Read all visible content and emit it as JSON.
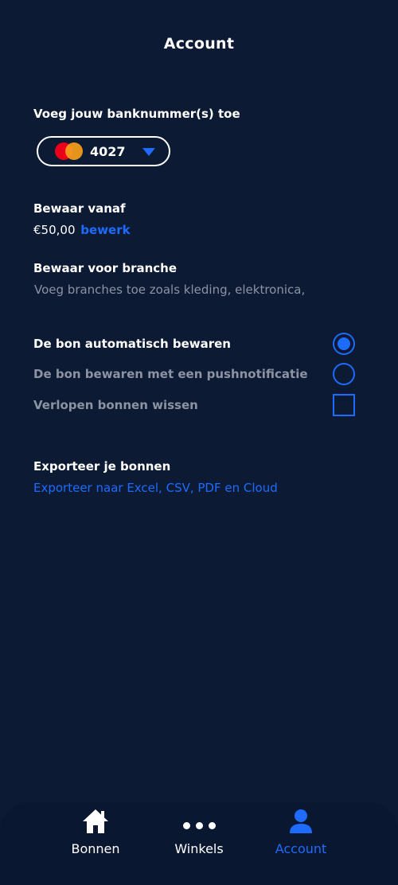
{
  "header": {
    "title": "Account"
  },
  "bank": {
    "label": "Voeg jouw banknummer(s) toe",
    "card_icon": "mastercard-logo",
    "card_digits": "4027"
  },
  "save_from": {
    "label": "Bewaar vanaf",
    "amount": "€50,00",
    "edit_label": "bewerk"
  },
  "branch": {
    "label": "Bewaar voor branche",
    "placeholder": "Voeg branches toe zoals kleding, elektronica,"
  },
  "options": [
    {
      "label": "De bon automatisch bewaren",
      "control": "radio",
      "checked": true
    },
    {
      "label": "De bon bewaren met een pushnotificatie",
      "control": "radio",
      "checked": false
    },
    {
      "label": "Verlopen bonnen wissen",
      "control": "checkbox",
      "checked": false
    }
  ],
  "export": {
    "label": "Exporteer je bonnen",
    "link": "Exporteer naar Excel, CSV, PDF en Cloud"
  },
  "nav": {
    "items": [
      {
        "label": "Bonnen",
        "icon": "home-icon",
        "active": false
      },
      {
        "label": "Winkels",
        "icon": "more-dots-icon",
        "active": false
      },
      {
        "label": "Account",
        "icon": "person-icon",
        "active": true
      }
    ]
  },
  "colors": {
    "background": "#0c1a33",
    "accent": "#1e6bff",
    "muted_text": "#8c93a3"
  }
}
